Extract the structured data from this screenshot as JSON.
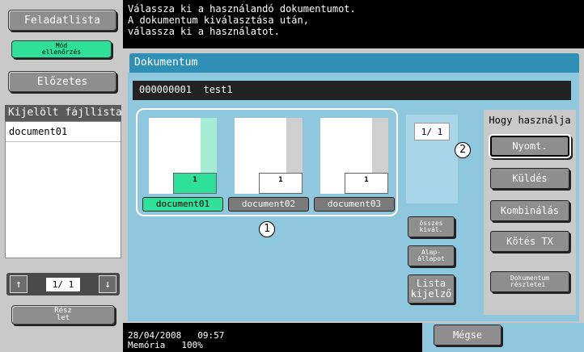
{
  "left": {
    "job_list_label": "Feladatlista",
    "mode_check_label": "Mód\nellenőrzés",
    "preview_label": "Előzetes",
    "file_list_header": "Kijelölt fájllista",
    "file_list": [
      {
        "name": "document01"
      }
    ],
    "pager": {
      "text": "1/ 1"
    },
    "detail_label": "Rész\nlet"
  },
  "header": {
    "message": "Válassza ki a használandó dokumentumot.\nA dokumentum kiválasztása után,\nválassza ki a használatot."
  },
  "main": {
    "tab_label": "Dokumentum",
    "box_id": "000000001",
    "box_name": "test1",
    "thumbnails": [
      {
        "label": "document01",
        "count": "1",
        "selected": true
      },
      {
        "label": "document02",
        "count": "1",
        "selected": false
      },
      {
        "label": "document03",
        "count": "1",
        "selected": false
      }
    ],
    "page_indicator": "1/ 1",
    "select_all_label": "összes\nkivál.",
    "reset_label": "Alap-\nállapot",
    "list_view_label": "Lista\nkijelző",
    "callouts": [
      "1",
      "2"
    ]
  },
  "usage": {
    "title": "Hogy használja",
    "buttons": [
      "Nyomt.",
      "Küldés",
      "Kombinálás",
      "Kötés TX"
    ],
    "details_label": "Dokumentum\nrészletei"
  },
  "status": {
    "date": "28/04/2008",
    "time": "09:57",
    "memory_label": "Memória",
    "memory_value": "100%",
    "cancel_label": "Mégse"
  },
  "colors": {
    "accent_green": "#2fe09a",
    "panel_blue": "#8fc7de",
    "tab_blue": "#2f8fb5"
  }
}
